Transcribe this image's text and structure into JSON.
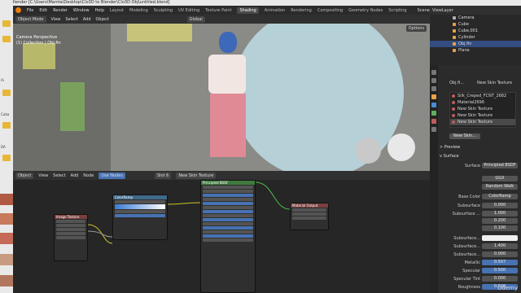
{
  "titlebar": {
    "text": "Blender [C:\\Users\\Mamta\\Desktop\\Clo3D to Blender\\Clo3D Obj\\untitled.blend]"
  },
  "menu": {
    "items": [
      "File",
      "Edit",
      "Render",
      "Window",
      "Help"
    ],
    "workspaces": [
      "Layout",
      "Modeling",
      "Sculpting",
      "UV Editing",
      "Texture Paint",
      "Shading",
      "Animation",
      "Rendering",
      "Compositing",
      "Geometry Nodes",
      "Scripting"
    ],
    "active_workspace": "Shading",
    "scene": "Scene",
    "view_layer": "ViewLayer"
  },
  "viewport_header": {
    "mode": "Object Mode",
    "view": "View",
    "select": "Select",
    "add": "Add",
    "object": "Object",
    "transform": "Global",
    "options": "Options"
  },
  "viewport": {
    "line1": "Camera Perspective",
    "line2": "(1) Collection | Obj.fin"
  },
  "node_header": {
    "type": "Object",
    "view": "View",
    "select": "Select",
    "add": "Add",
    "node": "Node",
    "use_nodes": "Use Nodes",
    "slot": "Slot 6",
    "material": "New Skin Texture"
  },
  "nodes": {
    "image": "Image Texture",
    "ramp": "ColorRamp",
    "bsdf": "Principled BSDF",
    "bsdf_label": "BSDF",
    "output": "Material Output"
  },
  "outliner": {
    "items": [
      {
        "label": "Camera",
        "color": "#b1b1b1"
      },
      {
        "label": "Cube",
        "color": "#e8a24a"
      },
      {
        "label": "Cube.001",
        "color": "#e8a24a"
      },
      {
        "label": "Cylinder",
        "color": "#e8a24a"
      },
      {
        "label": "Obj.fin",
        "color": "#e8a24a",
        "selected": true
      },
      {
        "label": "Plane",
        "color": "#e8a24a"
      }
    ]
  },
  "properties": {
    "breadcrumb": [
      "Obj.fi...",
      "New Skin Texture"
    ],
    "materials": [
      {
        "label": "Silk_Creped_FCNT_2682"
      },
      {
        "label": "Material2696"
      },
      {
        "label": "New Skin Texture"
      },
      {
        "label": "New Skin Texture"
      },
      {
        "label": "New Skin Texture",
        "selected": true
      }
    ],
    "material_field": "New Skin...",
    "preview": "Preview",
    "surface_section": "Surface",
    "surface_label": "Surface",
    "surface_value": "Principled BSDF",
    "ggx": "GGX",
    "random_walk": "Random Walk",
    "base_color_label": "Base Color",
    "base_color_value": "ColorRamp",
    "rows": [
      {
        "label": "Subsurface",
        "value": "0.000"
      },
      {
        "label": "Subsurface ...",
        "value": "1.000"
      },
      {
        "label": "",
        "value": "0.200"
      },
      {
        "label": "",
        "value": "0.100"
      },
      {
        "label": "Subsurface...",
        "value": ""
      },
      {
        "label": "Subsurface...",
        "value": "1.400"
      },
      {
        "label": "Subsurface...",
        "value": "0.000"
      },
      {
        "label": "Metallic",
        "value": "0.507"
      },
      {
        "label": "Specular",
        "value": "0.500"
      },
      {
        "label": "Specular Tint",
        "value": "0.000"
      },
      {
        "label": "Roughness",
        "value": "0.500"
      }
    ]
  },
  "watermark": "Udemy",
  "leftstrip": {
    "labels": [
      "Ai",
      "Cuba",
      "DA"
    ]
  }
}
